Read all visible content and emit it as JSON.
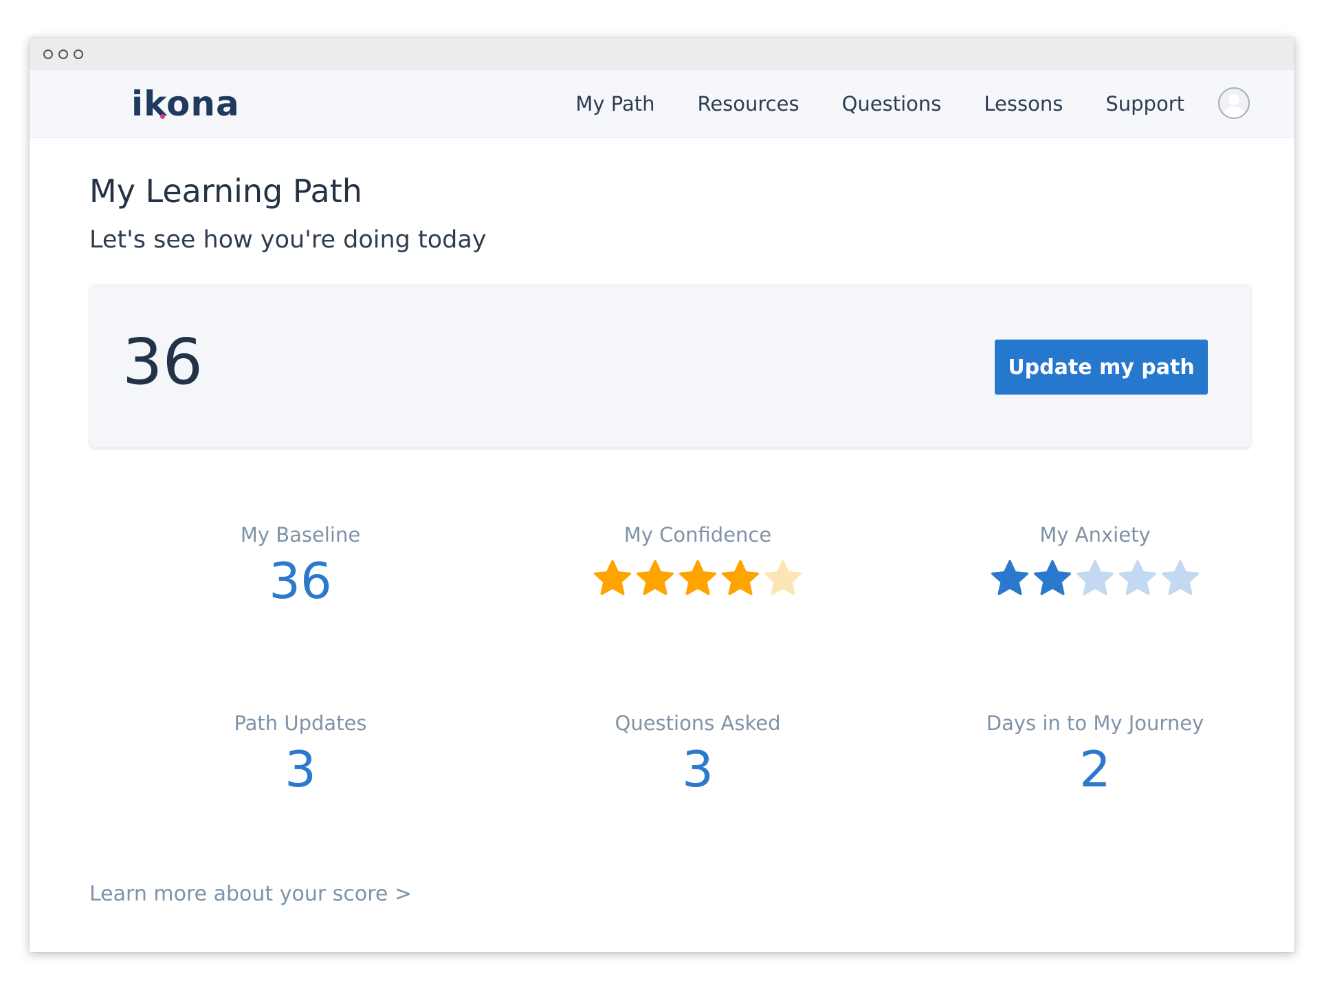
{
  "brand": {
    "logo_text": "ikona"
  },
  "nav": {
    "links": [
      "My Path",
      "Resources",
      "Questions",
      "Lessons",
      "Support"
    ]
  },
  "page": {
    "title": "My Learning Path",
    "subtitle": "Let's see how you're doing today"
  },
  "score_card": {
    "score": "36",
    "button_label": "Update my path"
  },
  "stats": {
    "baseline": {
      "label": "My Baseline",
      "value": "36"
    },
    "confidence": {
      "label": "My Confidence",
      "rating": 4,
      "max": 5,
      "filled_color": "#ffa300",
      "empty_color": "#fde6b5"
    },
    "anxiety": {
      "label": "My Anxiety",
      "rating": 2,
      "max": 5,
      "filled_color": "#2a79cc",
      "empty_color": "#c2d9f1"
    },
    "path_updates": {
      "label": "Path Updates",
      "value": "3"
    },
    "questions_asked": {
      "label": "Questions Asked",
      "value": "3"
    },
    "days": {
      "label": "Days in to My Journey",
      "value": "2"
    }
  },
  "footer": {
    "learn_more": "Learn more about your score >"
  },
  "icons": [
    "star-icon",
    "avatar-icon"
  ]
}
